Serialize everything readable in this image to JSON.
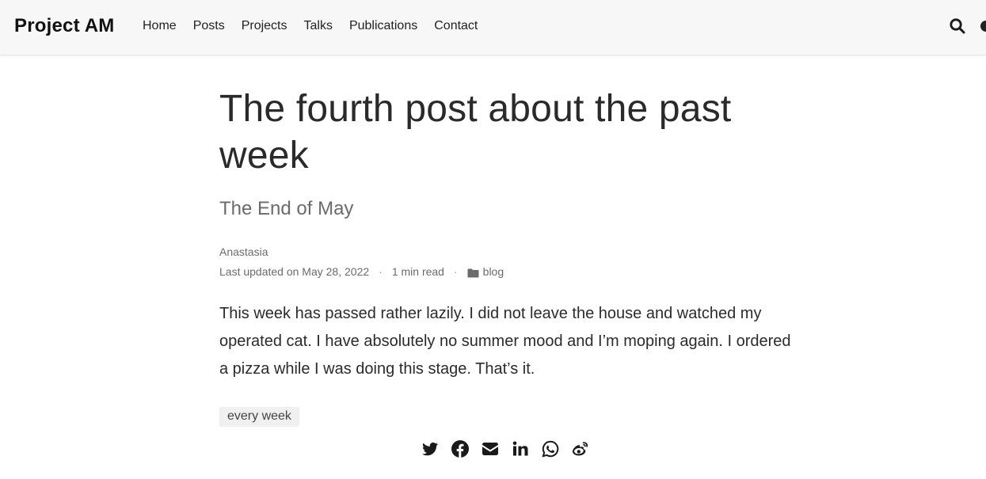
{
  "site": {
    "brand": "Project AM",
    "nav": [
      {
        "label": "Home"
      },
      {
        "label": "Posts"
      },
      {
        "label": "Projects"
      },
      {
        "label": "Talks"
      },
      {
        "label": "Publications"
      },
      {
        "label": "Contact"
      }
    ],
    "search_icon": "search-icon",
    "theme_icon": "moon-icon"
  },
  "post": {
    "title": "The fourth post about the past week",
    "subtitle": "The End of May",
    "author": "Anastasia",
    "last_updated": "Last updated on May 28, 2022",
    "separator": "·",
    "read_time": "1 min read",
    "category": "blog",
    "category_icon": "folder-icon",
    "body": "This week has passed rather lazily. I did not leave the house and watched my operated cat. I have absolutely no summer mood and I’m moping again. I ordered a pizza while I was doing this stage. That’s it.",
    "tags": [
      "every week"
    ]
  },
  "share": {
    "icons": [
      "twitter-icon",
      "facebook-icon",
      "email-icon",
      "linkedin-icon",
      "whatsapp-icon",
      "weibo-icon"
    ]
  },
  "colors": {
    "navbar_bg": "#f7f7f7",
    "text": "#2b2b2b",
    "muted": "#6b6b6b",
    "tag_bg": "#f0f0f0"
  }
}
